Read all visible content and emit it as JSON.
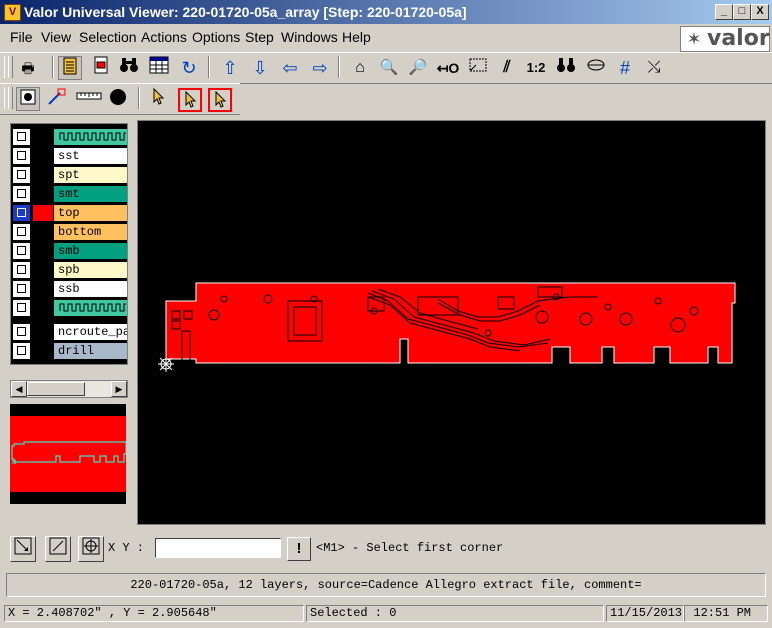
{
  "window": {
    "title": "Valor Universal Viewer: 220-01720-05a_array [Step: 220-01720-05a]",
    "app_icon": "app-icon",
    "minimize": "_",
    "maximize": "□",
    "close": "X"
  },
  "menu": {
    "items": [
      "File",
      "View",
      "Selection",
      "Actions",
      "Options",
      "Step",
      "Windows",
      "Help"
    ]
  },
  "logo": {
    "text": "valor"
  },
  "toolbar": {
    "one_to_two": "1:2"
  },
  "layers": [
    {
      "name": "",
      "color": "#40c8a0",
      "kind": "pattern",
      "selected": false
    },
    {
      "name": "sst",
      "color": "#ffffff",
      "selected": false
    },
    {
      "name": "spt",
      "color": "#fff8c8",
      "selected": false
    },
    {
      "name": "smt",
      "color": "#00a080",
      "selected": false
    },
    {
      "name": "top",
      "color": "#ffc060",
      "selected": true,
      "swatch": "#ff0000"
    },
    {
      "name": "bottom",
      "color": "#ffc060",
      "selected": false
    },
    {
      "name": "smb",
      "color": "#00a080",
      "selected": false
    },
    {
      "name": "spb",
      "color": "#fff8c8",
      "selected": false
    },
    {
      "name": "ssb",
      "color": "#ffffff",
      "selected": false
    },
    {
      "name": "",
      "color": "#40c8a0",
      "kind": "pattern",
      "selected": false
    },
    {
      "name": "ncroute_pa",
      "color": "#ffffff",
      "selected": false
    },
    {
      "name": "drill",
      "color": "#a8b8c8",
      "selected": false
    }
  ],
  "colors": {
    "board": "#ff0000",
    "outline": "#ffffff",
    "viewport_bg": "#000000",
    "mini_outline": "#40e0c0"
  },
  "command": {
    "xy_label": "X Y :",
    "xy_value": "",
    "exclaim": "!",
    "prompt": "<M1> - Select first corner"
  },
  "info": "220-01720-05a, 12 layers, source=Cadence Allegro extract file, comment=",
  "status": {
    "coords": "X = 2.408702\" , Y = 2.905648\"",
    "selected": "Selected : 0",
    "date": "11/15/2013",
    "time": "12:51 PM"
  }
}
